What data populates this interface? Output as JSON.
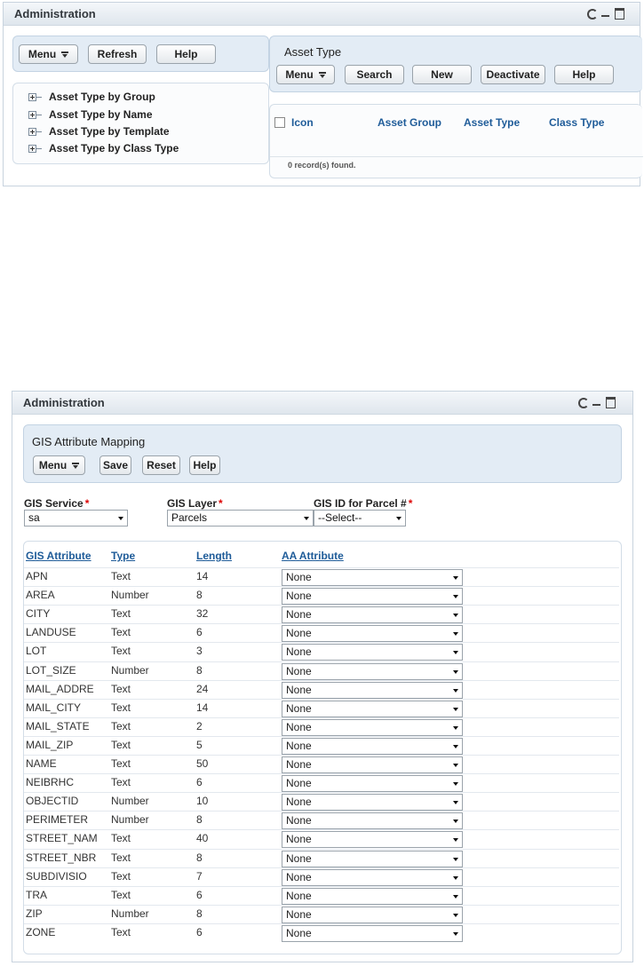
{
  "top_portlet": {
    "title": "Administration",
    "left_toolbar": {
      "menu": "Menu",
      "refresh": "Refresh",
      "help": "Help"
    },
    "tree": [
      "Asset Type by Group",
      "Asset Type by Name",
      "Asset Type by Template",
      "Asset Type by Class Type"
    ],
    "asset_type": {
      "title": "Asset Type",
      "buttons": {
        "menu": "Menu",
        "search": "Search",
        "new": "New",
        "deactivate": "Deactivate",
        "help": "Help"
      },
      "columns": [
        "Icon",
        "Asset Group",
        "Asset Type",
        "Class Type"
      ],
      "records": "0 record(s) found."
    }
  },
  "bottom_portlet": {
    "title": "Administration",
    "mapping": {
      "title": "GIS Attribute Mapping",
      "buttons": {
        "menu": "Menu",
        "save": "Save",
        "reset": "Reset",
        "help": "Help"
      }
    },
    "fields": {
      "gis_service": {
        "label": "GIS Service",
        "value": "sa"
      },
      "gis_layer": {
        "label": "GIS Layer",
        "value": "Parcels"
      },
      "gis_id": {
        "label": "GIS ID for Parcel #",
        "value": "--Select--"
      },
      "required_mark": "*"
    },
    "table": {
      "headers": [
        "GIS Attribute",
        "Type",
        "Length",
        "AA Attribute"
      ],
      "rows": [
        {
          "attr": "APN",
          "type": "Text",
          "length": "14",
          "aa": "None"
        },
        {
          "attr": "AREA",
          "type": "Number",
          "length": "8",
          "aa": "None"
        },
        {
          "attr": "CITY",
          "type": "Text",
          "length": "32",
          "aa": "None"
        },
        {
          "attr": "LANDUSE",
          "type": "Text",
          "length": "6",
          "aa": "None"
        },
        {
          "attr": "LOT",
          "type": "Text",
          "length": "3",
          "aa": "None"
        },
        {
          "attr": "LOT_SIZE",
          "type": "Number",
          "length": "8",
          "aa": "None"
        },
        {
          "attr": "MAIL_ADDRE",
          "type": "Text",
          "length": "24",
          "aa": "None"
        },
        {
          "attr": "MAIL_CITY",
          "type": "Text",
          "length": "14",
          "aa": "None"
        },
        {
          "attr": "MAIL_STATE",
          "type": "Text",
          "length": "2",
          "aa": "None"
        },
        {
          "attr": "MAIL_ZIP",
          "type": "Text",
          "length": "5",
          "aa": "None"
        },
        {
          "attr": "NAME",
          "type": "Text",
          "length": "50",
          "aa": "None"
        },
        {
          "attr": "NEIBRHC",
          "type": "Text",
          "length": "6",
          "aa": "None"
        },
        {
          "attr": "OBJECTID",
          "type": "Number",
          "length": "10",
          "aa": "None"
        },
        {
          "attr": "PERIMETER",
          "type": "Number",
          "length": "8",
          "aa": "None"
        },
        {
          "attr": "STREET_NAM",
          "type": "Text",
          "length": "40",
          "aa": "None"
        },
        {
          "attr": "STREET_NBR",
          "type": "Text",
          "length": "8",
          "aa": "None"
        },
        {
          "attr": "SUBDIVISIO",
          "type": "Text",
          "length": "7",
          "aa": "None"
        },
        {
          "attr": "TRA",
          "type": "Text",
          "length": "6",
          "aa": "None"
        },
        {
          "attr": "ZIP",
          "type": "Number",
          "length": "8",
          "aa": "None"
        },
        {
          "attr": "ZONE",
          "type": "Text",
          "length": "6",
          "aa": "None"
        }
      ]
    }
  }
}
